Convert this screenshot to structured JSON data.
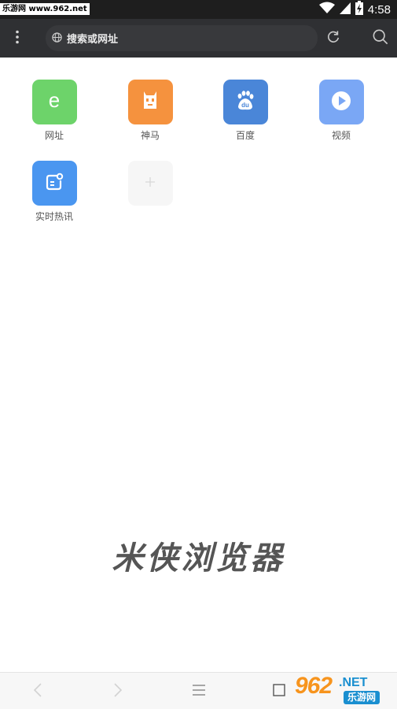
{
  "status_bar": {
    "watermark": "乐游网 www.962.net",
    "time": "4:58",
    "icons": [
      "wifi-icon",
      "signal-icon",
      "battery-charging-icon"
    ]
  },
  "toolbar": {
    "address_placeholder": "搜索或网址",
    "icons": [
      "menu-dots-icon",
      "globe-icon",
      "refresh-icon",
      "search-icon"
    ]
  },
  "speed_dial": [
    {
      "label": "网址",
      "icon": "e-letter-icon",
      "color": "#6dd36a"
    },
    {
      "label": "神马",
      "icon": "shenma-icon",
      "color": "#f5923e"
    },
    {
      "label": "百度",
      "icon": "baidu-paw-icon",
      "color": "#4a86d8"
    },
    {
      "label": "视频",
      "icon": "play-icon",
      "color": "#7aa7f5"
    },
    {
      "label": "实时热讯",
      "icon": "news-icon",
      "color": "#4a96f0"
    },
    {
      "label": "",
      "icon": "add-icon",
      "color": "#f6f6f6"
    }
  ],
  "brand_text": "米侠浏览器",
  "bottom_nav": {
    "icons": [
      "back-icon",
      "forward-icon",
      "menu-icon",
      "tabs-icon"
    ]
  },
  "corner_watermark": {
    "number": "962",
    "domain": ".NET",
    "name": "乐游网"
  }
}
